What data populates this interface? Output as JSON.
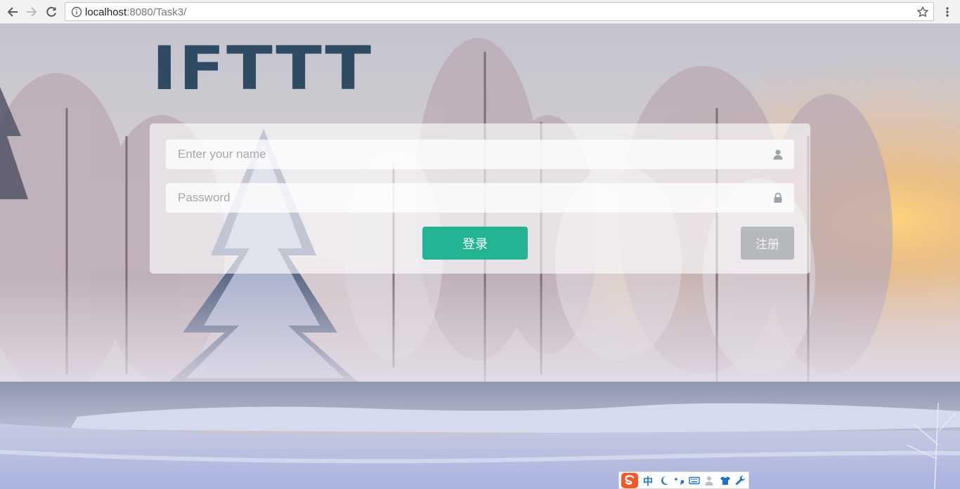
{
  "browser": {
    "url_host": "localhost",
    "url_rest": ":8080/Task3/"
  },
  "page": {
    "logo": "IFTTT",
    "username_placeholder": "Enter your name",
    "password_placeholder": "Password",
    "login_label": "登录",
    "register_label": "注册"
  },
  "ime_toolbar": {
    "language": "中"
  },
  "colors": {
    "logo": "#2f4a63",
    "login_button": "#22b493",
    "register_button": "#a5aab0"
  }
}
